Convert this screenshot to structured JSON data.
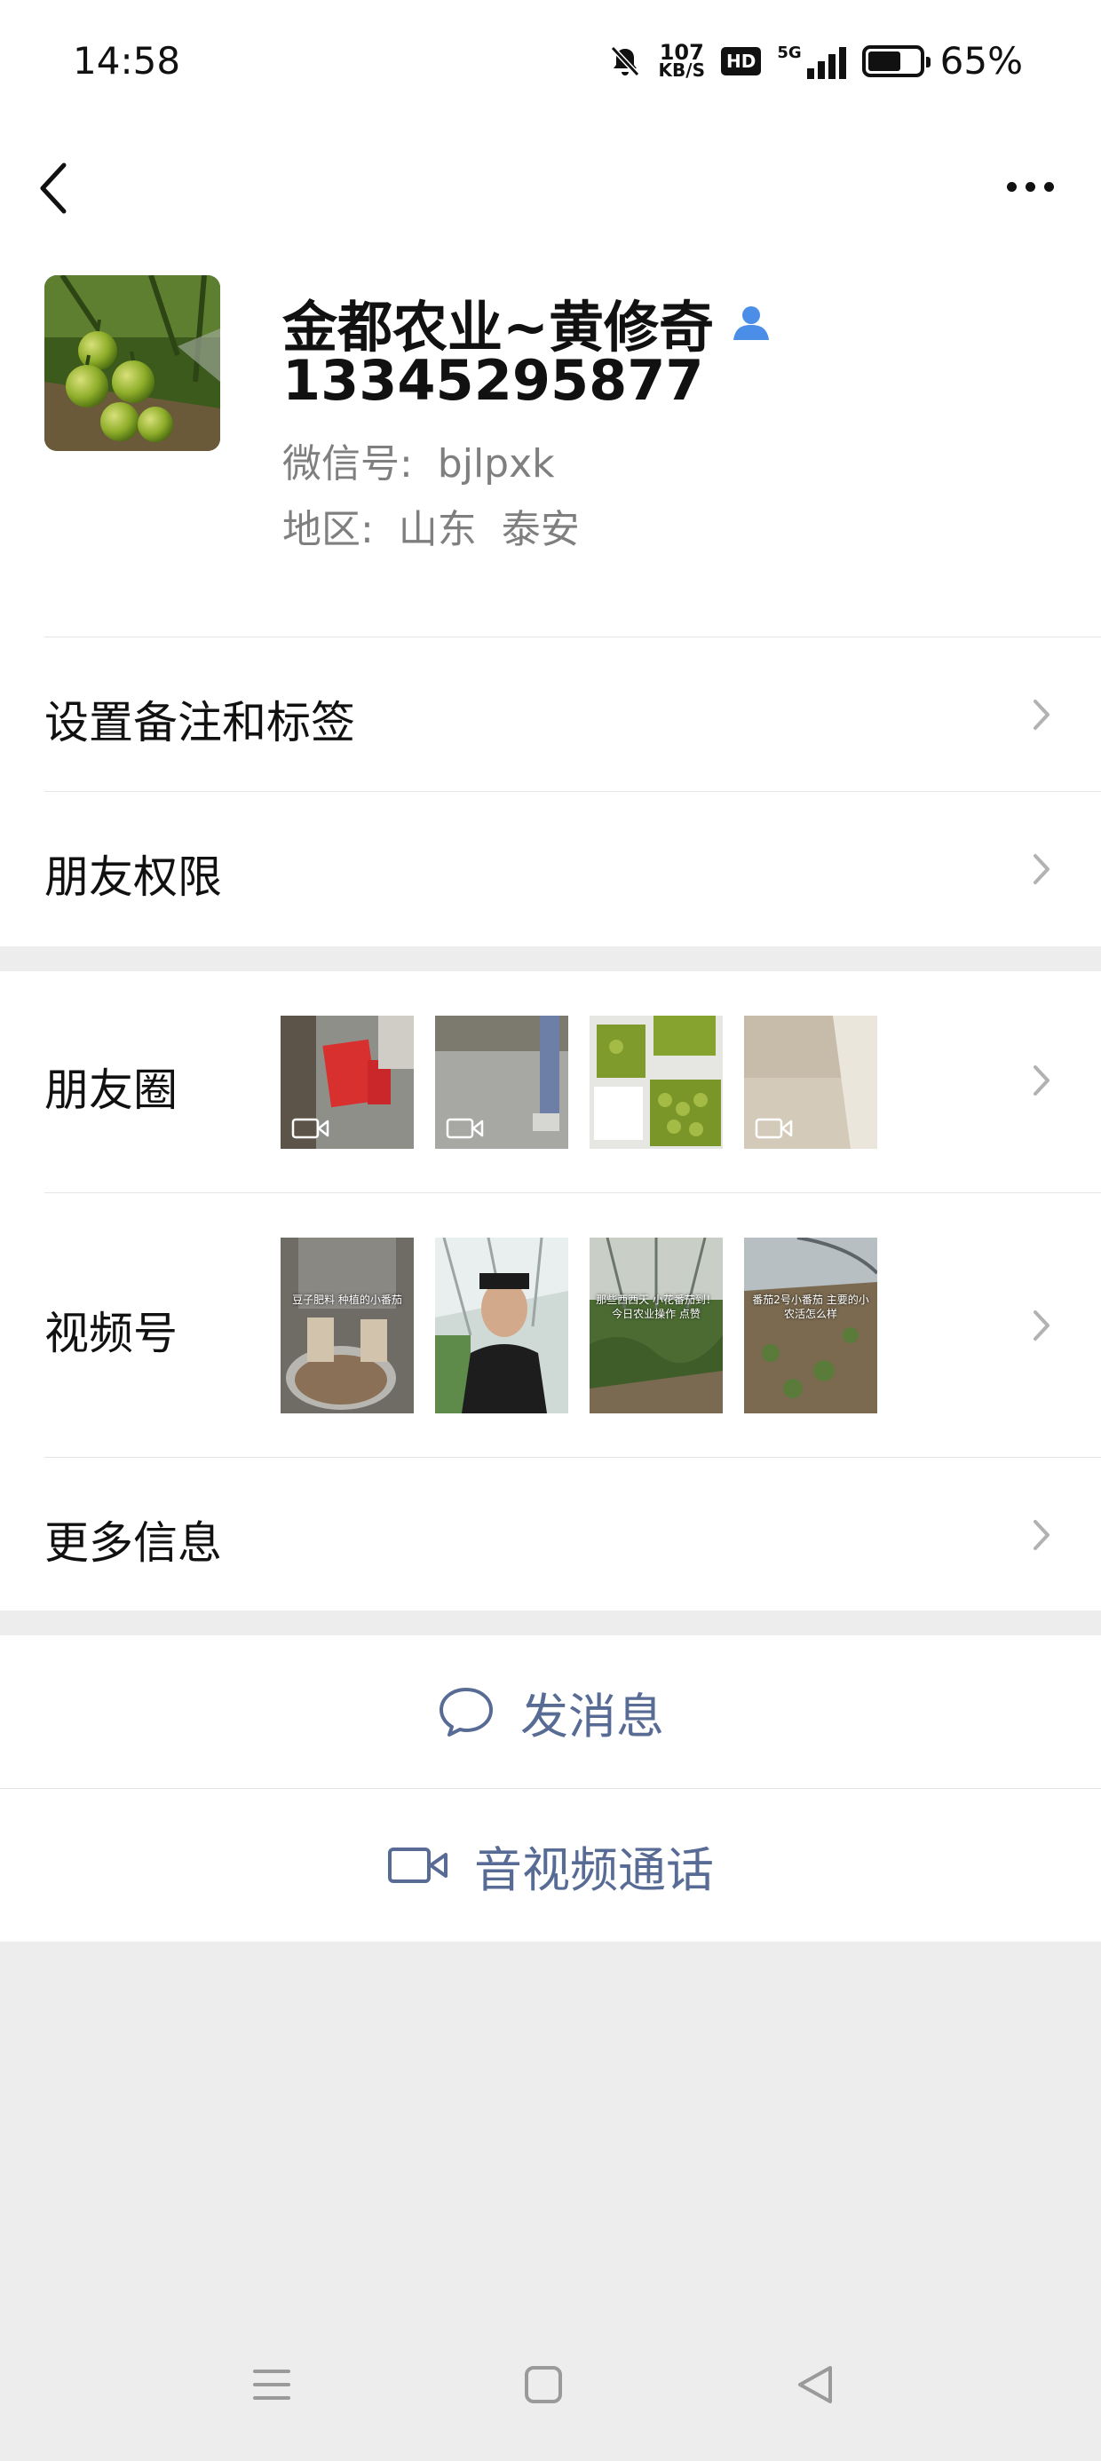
{
  "status_bar": {
    "time": "14:58",
    "net_speed_value": "107",
    "net_speed_unit": "KB/S",
    "hd_label": "HD",
    "network_label": "5G",
    "battery_percent_text": "65%",
    "battery_level": 0.65
  },
  "profile": {
    "name": "金都农业~黄修奇",
    "phone": "13345295877",
    "wechat_id": "微信号:  bjlpxk",
    "region": "地区:  山东  泰安"
  },
  "menu": {
    "remark_tags": "设置备注和标签",
    "friend_permissions": "朋友权限",
    "moments": "朋友圈",
    "channels": "视频号",
    "more_info": "更多信息"
  },
  "channels_captions": [
    "豆子肥料 种植的小番茄",
    "",
    "那些西西天 小花番茄到！ 今日农业操作 点赞",
    "番茄2号小番茄 主要的小农活怎么样"
  ],
  "actions": {
    "send_message": "发消息",
    "video_call": "音视频通话"
  },
  "colors": {
    "accent_link": "#576b95",
    "verified_icon": "#4b8ee8",
    "page_bg": "#ededed"
  },
  "icons": [
    "back-icon",
    "more-icon",
    "verified-user-icon",
    "chevron-right-icon",
    "video-icon",
    "chat-bubble-icon",
    "video-camera-icon",
    "menu-icon",
    "home-icon",
    "back-triangle-icon"
  ]
}
